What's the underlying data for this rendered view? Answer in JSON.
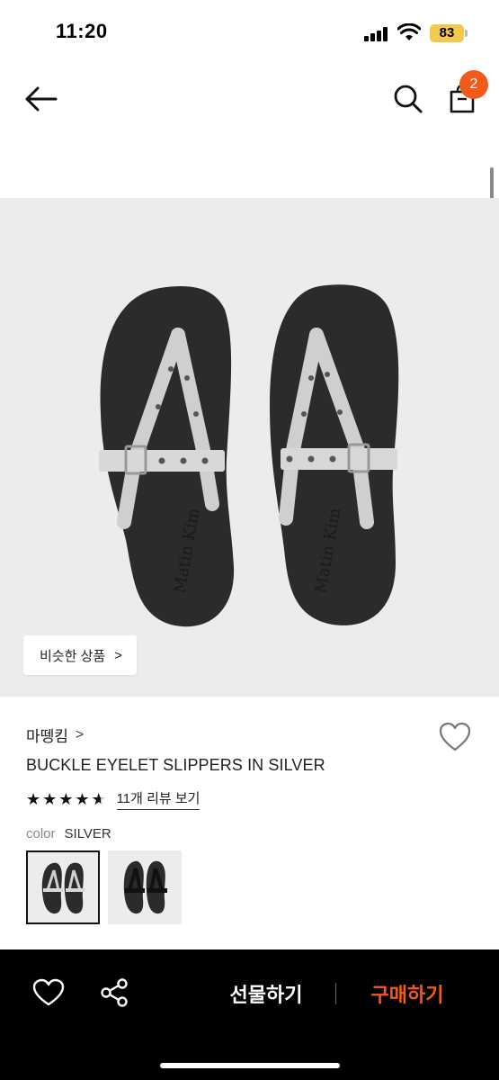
{
  "status_bar": {
    "time": "11:20",
    "battery": "83",
    "battery_color": "#f2c94c"
  },
  "header": {
    "back_icon": "arrow-left-icon",
    "search_icon": "search-icon",
    "bag_icon": "shopping-bag-icon",
    "cart_count": "2",
    "badge_color": "#f25a1a"
  },
  "hero": {
    "image_brand_text": "Matin Kim",
    "similar_products_label": "비슷한 상품",
    "similar_products_chevron": ">"
  },
  "product": {
    "brand": "마뗑킴",
    "brand_chevron": ">",
    "title": "BUCKLE EYELET SLIPPERS IN SILVER",
    "rating": 4.5,
    "rating_max": 5,
    "review_link": "11개 리뷰 보기",
    "color_label": "color",
    "color_value": "SILVER",
    "swatches": [
      {
        "name": "silver",
        "selected": true
      },
      {
        "name": "black",
        "selected": false
      }
    ]
  },
  "bottom_bar": {
    "wishlist_icon": "heart-icon",
    "share_icon": "share-icon",
    "gift_label": "선물하기",
    "buy_label": "구매하기",
    "accent_color": "#f25a1a"
  }
}
